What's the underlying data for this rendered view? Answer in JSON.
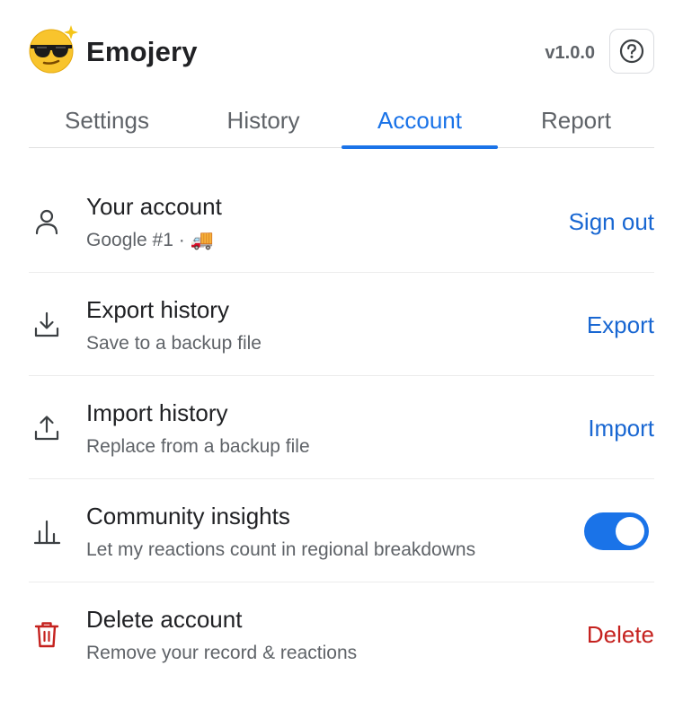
{
  "header": {
    "app_name": "Emojery",
    "version": "v1.0.0",
    "help_icon": "question-circle-icon"
  },
  "tabs": [
    {
      "label": "Settings",
      "active": false
    },
    {
      "label": "History",
      "active": false
    },
    {
      "label": "Account",
      "active": true
    },
    {
      "label": "Report",
      "active": false
    }
  ],
  "account_rows": [
    {
      "icon": "person-icon",
      "title": "Your account",
      "subtitle": "Google #1 · ",
      "badge_emoji": "🚚",
      "action": "Sign out"
    },
    {
      "icon": "download-icon",
      "title": "Export history",
      "subtitle": "Save to a backup file",
      "action": "Export"
    },
    {
      "icon": "upload-icon",
      "title": "Import history",
      "subtitle": "Replace from a backup file",
      "action": "Import"
    },
    {
      "icon": "bar-chart-icon",
      "title": "Community insights",
      "subtitle": "Let my reactions count in regional breakdowns",
      "toggle_on": true
    },
    {
      "icon": "trash-icon",
      "title": "Delete account",
      "subtitle": "Remove your record & reactions",
      "action": "Delete"
    }
  ],
  "colors": {
    "accent": "#1a73e8",
    "link": "#1967d2",
    "danger": "#c5221f",
    "text_primary": "#202124",
    "text_secondary": "#5f6368"
  }
}
